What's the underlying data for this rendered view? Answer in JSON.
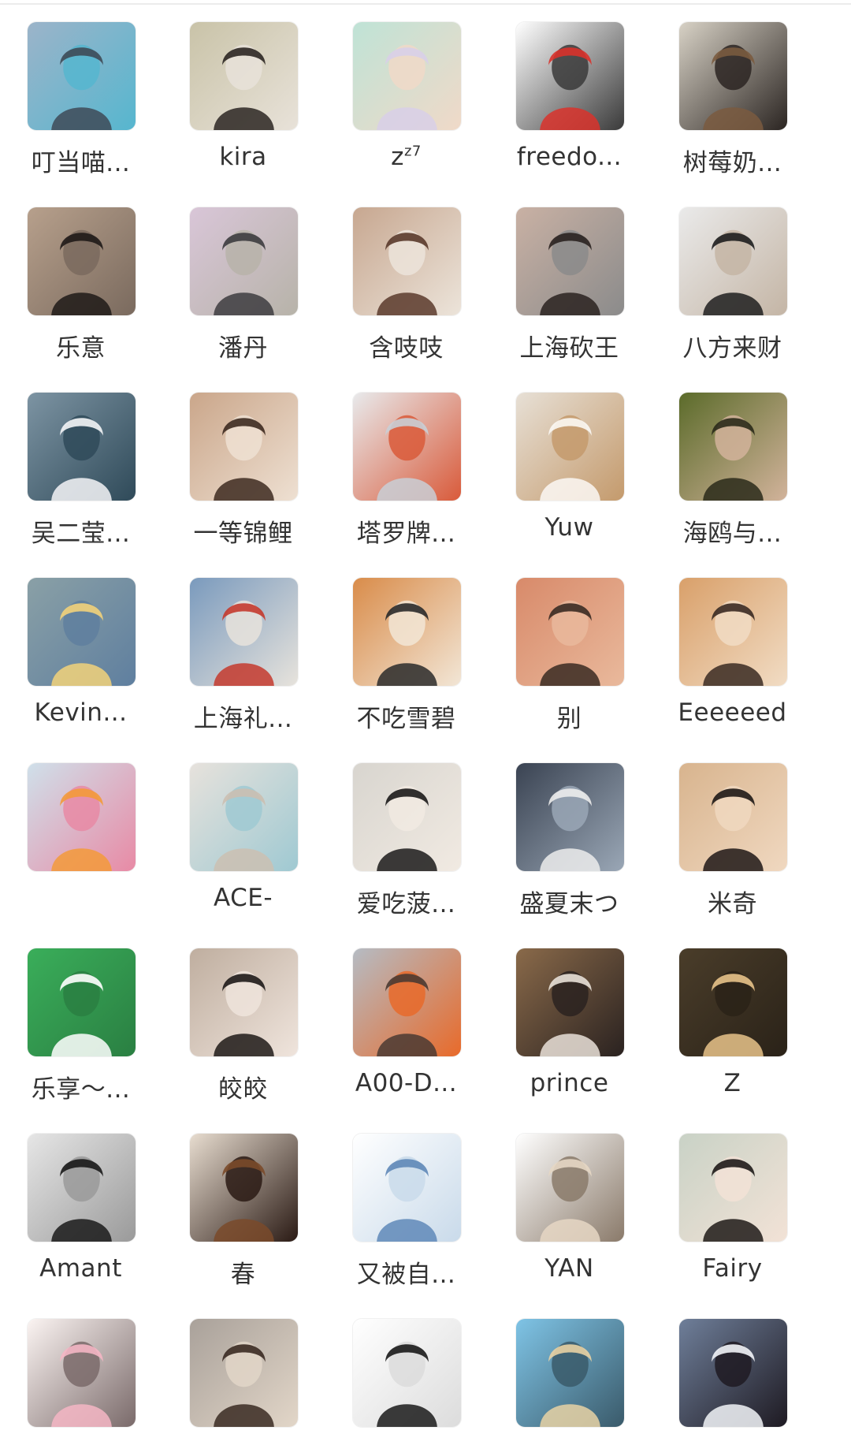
{
  "members": [
    {
      "name": "叮当喵...",
      "avatar": "woman-blue-top-beach",
      "c": [
        "#9cb4c9",
        "#3e4a57",
        "#56b6cf"
      ]
    },
    {
      "name": "kira",
      "avatar": "woman-with-cat",
      "c": [
        "#c9c3a8",
        "#2b2622",
        "#e8e2d9"
      ]
    },
    {
      "name": "z<sup>z7</sup>",
      "avatar": "painted-face",
      "c": [
        "#bfe3d6",
        "#d8cfe8",
        "#f0d9c8"
      ]
    },
    {
      "name": "freedo...",
      "avatar": "cartoon-cat-mushroom",
      "c": [
        "#ffffff",
        "#d9322b",
        "#3a3a3a"
      ]
    },
    {
      "name": "树莓奶...",
      "avatar": "girl-with-teddy",
      "c": [
        "#d8d2c6",
        "#7a5b3f",
        "#2b2522"
      ]
    },
    {
      "name": "乐意",
      "avatar": "woman-dark-hair",
      "c": [
        "#b7a08c",
        "#1f1a18",
        "#7a6a5e"
      ]
    },
    {
      "name": "潘丹",
      "avatar": "woman-in-car-blossom",
      "c": [
        "#d9c6d8",
        "#3d3c3f",
        "#b7b3a9"
      ]
    },
    {
      "name": "含吱吱",
      "avatar": "woman-smiling",
      "c": [
        "#c7a790",
        "#5a3a2b",
        "#ece4da"
      ]
    },
    {
      "name": "上海砍王",
      "avatar": "woman-portrait",
      "c": [
        "#c9b1a4",
        "#2a2220",
        "#8b8b8b"
      ]
    },
    {
      "name": "八方来财",
      "avatar": "woman-with-cup",
      "c": [
        "#eaeaea",
        "#1e1e1e",
        "#c4b5a5"
      ]
    },
    {
      "name": "吴二莹...",
      "avatar": "woman-lake-snow",
      "c": [
        "#7d94a3",
        "#f4f5f7",
        "#2f4a59"
      ]
    },
    {
      "name": "一等锦鲤",
      "avatar": "woman-peace-sign",
      "c": [
        "#caa68a",
        "#3d2a20",
        "#eee0d2"
      ]
    },
    {
      "name": "塔罗牌...",
      "avatar": "woman-gallery",
      "c": [
        "#e8eaec",
        "#c9cfd6",
        "#d95a3a"
      ]
    },
    {
      "name": "Yuw",
      "avatar": "white-cat",
      "c": [
        "#e7e0d6",
        "#fbf8f4",
        "#c49a6c"
      ]
    },
    {
      "name": "海鸥与...",
      "avatar": "opera-woman",
      "c": [
        "#5b6b2a",
        "#2a2a1a",
        "#d2b39b"
      ]
    },
    {
      "name": "Kevin...",
      "avatar": "man-sunglasses-blond",
      "c": [
        "#8aa0a6",
        "#f2d27a",
        "#5f7f9f"
      ]
    },
    {
      "name": "上海礼...",
      "avatar": "girl-palace",
      "c": [
        "#7a9abd",
        "#c43a2e",
        "#e7e3dc"
      ]
    },
    {
      "name": "不吃雪碧",
      "avatar": "girl-with-food",
      "c": [
        "#d98c4a",
        "#2a2a2a",
        "#f2e6d6"
      ]
    },
    {
      "name": "别",
      "avatar": "chubby-child",
      "c": [
        "#d88a6a",
        "#3a2a22",
        "#e9b99c"
      ]
    },
    {
      "name": "Eeeeeed",
      "avatar": "woman-sunset-beach",
      "c": [
        "#d9a06a",
        "#3a2a22",
        "#f1dcc4"
      ]
    },
    {
      "name": "",
      "avatar": "anime-girl",
      "c": [
        "#cfe0ea",
        "#f39a3a",
        "#e88aa5"
      ]
    },
    {
      "name": "ACE-",
      "avatar": "doll-with-bear",
      "c": [
        "#e7e2dc",
        "#cbbfb1",
        "#9fc9d2"
      ]
    },
    {
      "name": "爱吃菠...",
      "avatar": "woman-smile-white-top",
      "c": [
        "#d8d5cf",
        "#1b1a1a",
        "#f1eae2"
      ]
    },
    {
      "name": "盛夏末つ",
      "avatar": "woman-cap-apple-store",
      "c": [
        "#3a4352",
        "#ececec",
        "#9aa7b6"
      ]
    },
    {
      "name": "米奇",
      "avatar": "woman-lying",
      "c": [
        "#d8b48e",
        "#1e1816",
        "#f0d8c0"
      ]
    },
    {
      "name": "乐享～...",
      "avatar": "lexiang-logo",
      "c": [
        "#3aae5a",
        "#ffffff",
        "#2a7f42"
      ]
    },
    {
      "name": "皎皎",
      "avatar": "woman-closeup",
      "c": [
        "#bfae9f",
        "#1e1a18",
        "#efe4dc"
      ]
    },
    {
      "name": "A00-D...",
      "avatar": "muscular-man",
      "c": [
        "#b5bcc4",
        "#4a3a32",
        "#e86a2a"
      ]
    },
    {
      "name": "prince",
      "avatar": "couple-mirror",
      "c": [
        "#8a6a4a",
        "#e9e1d8",
        "#2a2220"
      ]
    },
    {
      "name": "Z",
      "avatar": "woman-forest",
      "c": [
        "#4a3d2a",
        "#e8c38a",
        "#2a2218"
      ]
    },
    {
      "name": "Amant",
      "avatar": "woman-monochrome",
      "c": [
        "#e6e6e6",
        "#1a1a1a",
        "#9a9a9a"
      ]
    },
    {
      "name": "春",
      "avatar": "woman-with-puppy",
      "c": [
        "#e8ddd0",
        "#7a4a2a",
        "#2a1a14"
      ]
    },
    {
      "name": "又被自...",
      "avatar": "blue-sketch-face",
      "c": [
        "#ffffff",
        "#5f88b8",
        "#c9daea"
      ]
    },
    {
      "name": "YAN",
      "avatar": "polaroid-photo",
      "c": [
        "#ffffff",
        "#e6d7c4",
        "#8a7a6a"
      ]
    },
    {
      "name": "Fairy",
      "avatar": "woman-hand-chin",
      "c": [
        "#c9d2c6",
        "#1e1a18",
        "#f2e2d6"
      ]
    },
    {
      "name": "",
      "avatar": "cartoon-bear-tennis",
      "c": [
        "#fbf4f2",
        "#f4b6c4",
        "#7a6a6a"
      ]
    },
    {
      "name": "",
      "avatar": "woman-street",
      "c": [
        "#a9a19a",
        "#3a2a22",
        "#e2d6c8"
      ]
    },
    {
      "name": "",
      "avatar": "manga-girl",
      "c": [
        "#ffffff",
        "#1a1a1a",
        "#dcdcdc"
      ]
    },
    {
      "name": "",
      "avatar": "child-beach",
      "c": [
        "#7fc4e6",
        "#e8d2a4",
        "#3a5a6a"
      ]
    },
    {
      "name": "",
      "avatar": "woman-snow",
      "c": [
        "#6f7f9a",
        "#f2f4f8",
        "#1e1a22"
      ]
    }
  ]
}
